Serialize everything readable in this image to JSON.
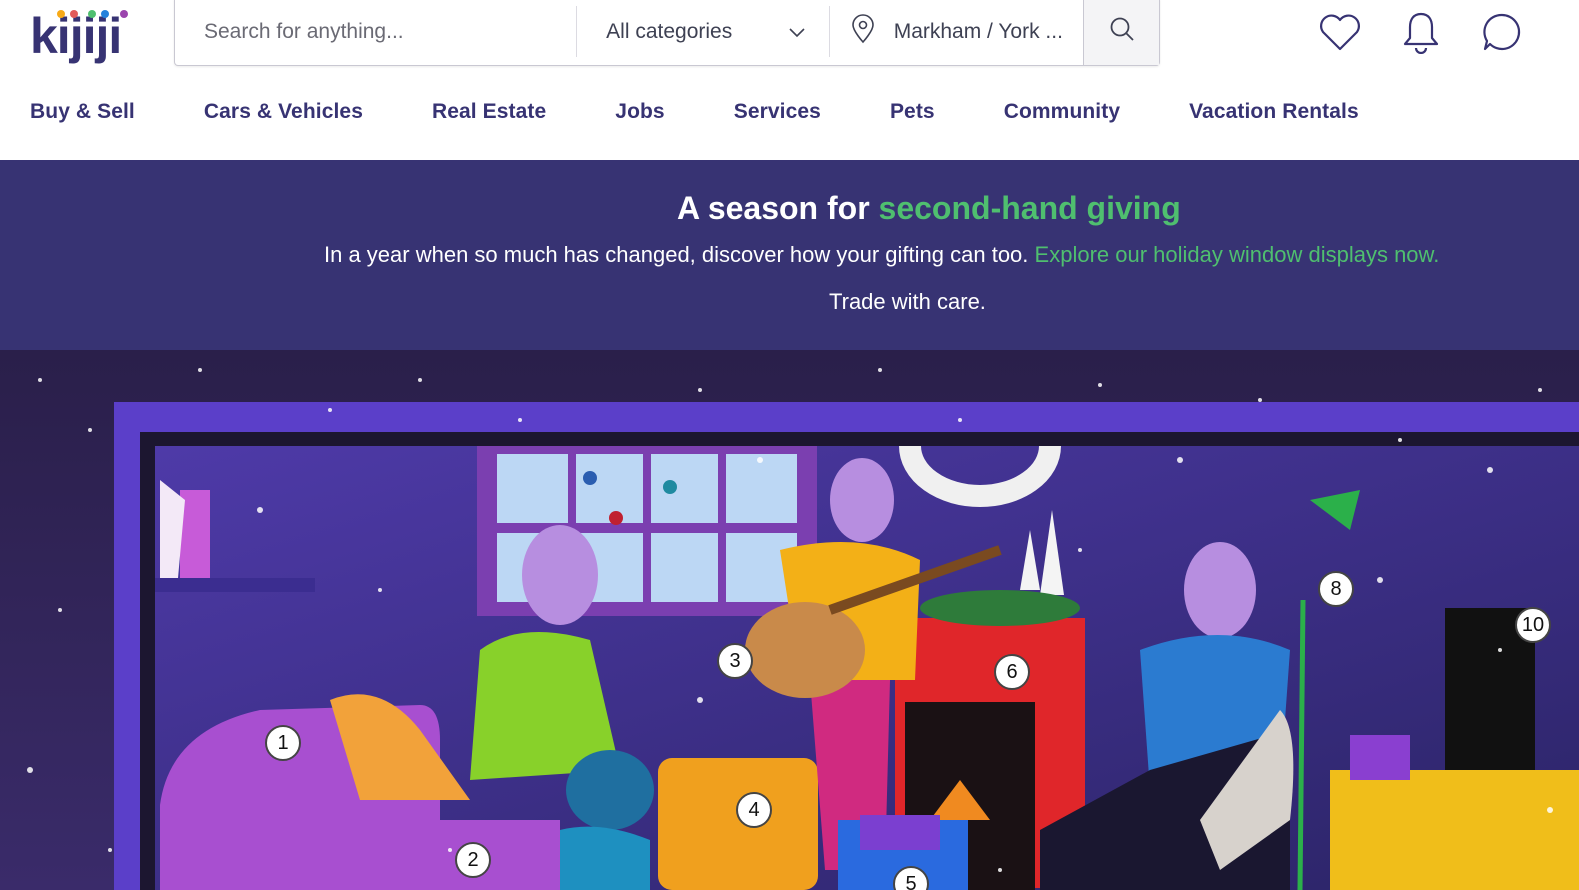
{
  "logo": {
    "text": "kijiji"
  },
  "search": {
    "placeholder": "Search for anything...",
    "category": "All categories",
    "location": "Markham / York ..."
  },
  "nav": {
    "items": [
      "Buy & Sell",
      "Cars & Vehicles",
      "Real Estate",
      "Jobs",
      "Services",
      "Pets",
      "Community",
      "Vacation Rentals"
    ]
  },
  "icons": {
    "favorites": "heart-icon",
    "notifications": "bell-icon",
    "messages": "chat-icon",
    "search": "search-icon",
    "location": "location-pin-icon",
    "dropdown": "chevron-down-icon"
  },
  "banner": {
    "title_prefix": "A season for",
    "title_highlight": "second-hand giving",
    "subtitle": "In a year when so much has changed, discover how your gifting can too.",
    "link": "Explore our holiday window displays now.",
    "tagline": "Trade with care."
  },
  "hotspots": [
    "1",
    "2",
    "3",
    "4",
    "5",
    "6",
    "8",
    "10"
  ],
  "colors": {
    "brand": "#373373",
    "accent_green": "#4fbf6f",
    "banner_bg": "#373373"
  }
}
